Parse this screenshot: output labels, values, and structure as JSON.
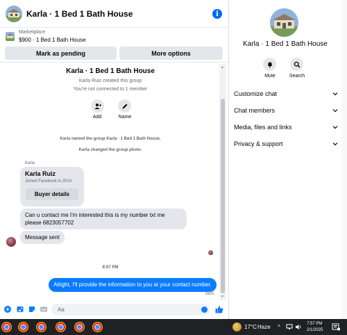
{
  "header": {
    "title": "Karla · 1 Bed 1 Bath House"
  },
  "marketplace": {
    "label": "Marketplace",
    "item": "$900 · 1 Bed 1 Bath House",
    "mark_pending": "Mark as pending",
    "more_options": "More options"
  },
  "thread": {
    "group_title": "Karla · 1 Bed 1 Bath House",
    "created": "Karla Ruiz created this group",
    "connected": "You're not connected to 1 member",
    "add_label": "Add",
    "name_label": "Name",
    "system_1": "Karla named the group Karla · 1 Bed 1 Bath House.",
    "system_2": "Karla changed the group photo.",
    "sender": "Karla",
    "card_name": "Karla Ruiz",
    "card_sub": "Joined Facebook in 2014",
    "card_button": "Buyer details",
    "msg_1": "Can u contact me I'm interested this is my number txt me please 6823057702",
    "msg_2": "Message sent",
    "time": "8:07 PM",
    "outgoing": "Alright, I'll provide the information to you at your contact number.",
    "sent_status": "Sent"
  },
  "composer": {
    "placeholder": "Aa"
  },
  "info": {
    "title": "Karla · 1 Bed 1 Bath House",
    "mute": "Mute",
    "search": "Search",
    "menu": [
      "Customize chat",
      "Chat members",
      "Media, files and links",
      "Privacy & support"
    ]
  },
  "taskbar": {
    "temp": "17°C",
    "weather": "Haze",
    "time": "7:57 PM",
    "date": "2/1/2025"
  },
  "colors": {
    "accent": "#0a7cff",
    "bubble_in": "#e4e6eb",
    "taskbar": "#202124"
  }
}
